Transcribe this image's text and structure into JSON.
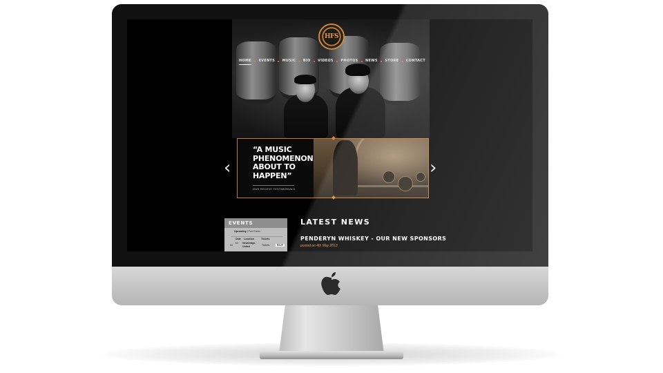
{
  "site": {
    "logo_text": "HFS",
    "nav": [
      {
        "label": "HOME",
        "active": true
      },
      {
        "label": "EVENTS"
      },
      {
        "label": "MUSIC"
      },
      {
        "label": "BIO"
      },
      {
        "label": "VIDEOS"
      },
      {
        "label": "PHOTOS"
      },
      {
        "label": "NEWS"
      },
      {
        "label": "STORE"
      },
      {
        "label": "CONTACT"
      }
    ],
    "slider": {
      "quote": "“A MUSIC PHENOMENON ABOUT TO HAPPEN”",
      "label": "OUR RECENT TESTIMONIALS",
      "prev_glyph": "‹",
      "next_glyph": "›"
    },
    "events": {
      "title": "EVENTS",
      "tab_upcoming": "Upcoming",
      "tab_separator": " | ",
      "tab_past": "Past Dates",
      "columns": [
        "Date",
        "Location",
        "Tickets"
      ],
      "rows": [
        {
          "day": "Jul",
          "date": "03",
          "location_line1": "Newbridge,",
          "location_line2": "United",
          "tickets": "Tickets",
          "rsvp": "RSVP"
        }
      ]
    },
    "news": {
      "heading": "LATEST NEWS",
      "items": [
        {
          "title": "PENDERYN WHISKEY - OUR NEW SPONSORS",
          "date": "posted on 4th May 2013"
        }
      ]
    }
  },
  "colors": {
    "accent": "#d98a36",
    "screen_bg": "#000000",
    "events_panel": "#bdbdbd"
  },
  "icons": {
    "device_logo": "apple-logo-icon",
    "prev": "chevron-left-icon",
    "next": "chevron-right-icon"
  }
}
